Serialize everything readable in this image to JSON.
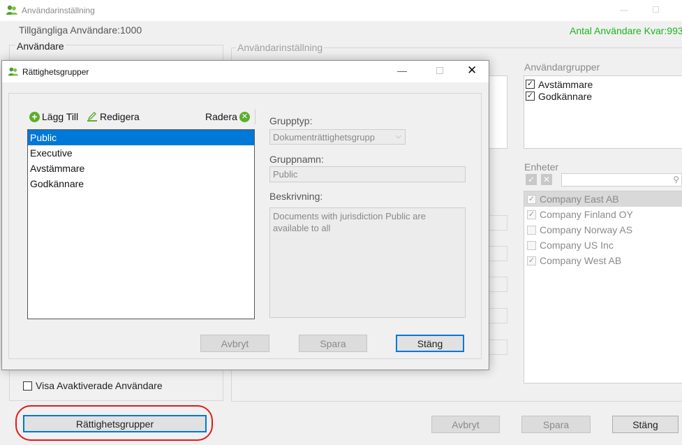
{
  "main_window": {
    "title": "Användarinställning",
    "available_users": "Tillgängliga Användare:1000",
    "remaining_users": "Antal Användare Kvar:993",
    "users_panel_title": "Användare",
    "settings_panel_title": "Användarinställning",
    "user_groups": {
      "label": "Användargrupper",
      "items": [
        {
          "label": "Avstämmare",
          "checked": true
        },
        {
          "label": "Godkännare",
          "checked": true
        }
      ]
    },
    "units": {
      "label": "Enheter",
      "items": [
        {
          "label": "Company East AB",
          "checked": true
        },
        {
          "label": "Company Finland OY",
          "checked": true
        },
        {
          "label": "Company Norway AS",
          "checked": false
        },
        {
          "label": "Company US Inc",
          "checked": false
        },
        {
          "label": "Company West AB",
          "checked": true
        }
      ]
    },
    "show_inactive_label": "Visa Avaktiverade Användare",
    "permission_groups_button": "Rättighetsgrupper",
    "cancel_button": "Avbryt",
    "save_button": "Spara",
    "close_button": "Stäng"
  },
  "dialog": {
    "title": "Rättighetsgrupper",
    "add_label": "Lägg Till",
    "edit_label": "Redigera",
    "delete_label": "Radera",
    "groups": [
      "Public",
      "Executive",
      "Avstämmare",
      "Godkännare"
    ],
    "selected_group": "Public",
    "group_type_label": "Grupptyp:",
    "group_type_value": "Dokumenträttighetsgrupp",
    "group_name_label": "Gruppnamn:",
    "group_name_value": "Public",
    "description_label": "Beskrivning:",
    "description_value": "Documents with jurisdiction Public are available to all",
    "cancel_button": "Avbryt",
    "save_button": "Spara",
    "close_button": "Stäng"
  },
  "colors": {
    "accent": "#0078d7",
    "remaining_text": "#1db41d",
    "icon_green": "#5cae2c",
    "highlight": "#e01b1b"
  }
}
